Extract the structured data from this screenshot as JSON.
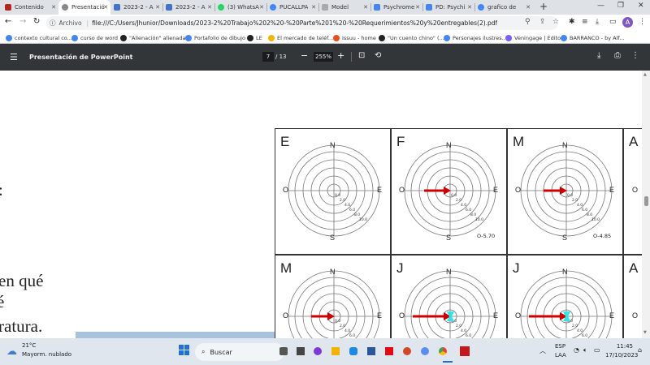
{
  "tabs": [
    {
      "label": "Contenido",
      "color": "#b3261e"
    },
    {
      "label": "Presentació",
      "color": "#888888",
      "active": true
    },
    {
      "label": "2023-2 - A",
      "color": "#4472c4"
    },
    {
      "label": "2023-2 - A",
      "color": "#4472c4"
    },
    {
      "label": "(3) WhatsA",
      "color": "#25d366"
    },
    {
      "label": "PUCALLPA",
      "color": "#4285f4"
    },
    {
      "label": "Model",
      "color": "#aaaaaa"
    },
    {
      "label": "Psychrome",
      "color": "#4285f4"
    },
    {
      "label": "PD: Psychi",
      "color": "#4285f4"
    },
    {
      "label": "grafico de",
      "color": "#4285f4"
    }
  ],
  "address": {
    "label": "Archivo",
    "url": "file:///C:/Users/Jhunior/Downloads/2023-2%20Trabajo%202%20-%20Parte%201%20-%20Requerimientos%20y%20entregables(2).pdf"
  },
  "bookmarks": [
    {
      "label": "contexto cultural co...",
      "color": "#4285f4"
    },
    {
      "label": "curso de word",
      "color": "#4285f4"
    },
    {
      "label": "\"Alienación\" alienada",
      "color": "#222222"
    },
    {
      "label": "Portafolio de dibujo",
      "color": "#4285f4"
    },
    {
      "label": "LE",
      "color": "#222222"
    },
    {
      "label": "El mercado de teléf...",
      "color": "#f4b400"
    },
    {
      "label": "Issuu - home",
      "color": "#e94e1b"
    },
    {
      "label": "\"Un cuento chino\" (...",
      "color": "#222222"
    },
    {
      "label": "Personajes ilustres...",
      "color": "#4285f4"
    },
    {
      "label": "Veningage | Editor",
      "color": "#7b5cff"
    },
    {
      "label": "BARRANCO - by Alf...",
      "color": "#4285f4"
    }
  ],
  "pdf": {
    "title": "Presentación de PowerPoint",
    "page": "7",
    "total": "/ 13",
    "zoom": "255%"
  },
  "left_text": [
    ":",
    "en qué",
    "é",
    "ratura."
  ],
  "cells_row1": [
    {
      "letter": "E",
      "value": "",
      "arrow": false
    },
    {
      "letter": "F",
      "value": "O-5.70",
      "arrow": true
    },
    {
      "letter": "M",
      "value": "O-4.85",
      "arrow": true
    },
    {
      "letter": "A",
      "value": "",
      "arrow": false
    }
  ],
  "cells_row2": [
    {
      "letter": "M",
      "arrow": true
    },
    {
      "letter": "J",
      "arrow": true
    },
    {
      "letter": "J",
      "arrow": true
    },
    {
      "letter": "A",
      "arrow": false
    }
  ],
  "compass": {
    "n": "N",
    "s": "S",
    "e": "E",
    "w": "O"
  },
  "rings": [
    "0.0",
    "2.0",
    "4.0",
    "6.0",
    "8.0",
    "10.0"
  ],
  "taskbar": {
    "temp": "21°C",
    "weather": "Mayorm. nublado",
    "search": "Buscar",
    "lang1": "ESP",
    "lang2": "LAA",
    "time": "11:45",
    "date": "17/10/2023"
  }
}
